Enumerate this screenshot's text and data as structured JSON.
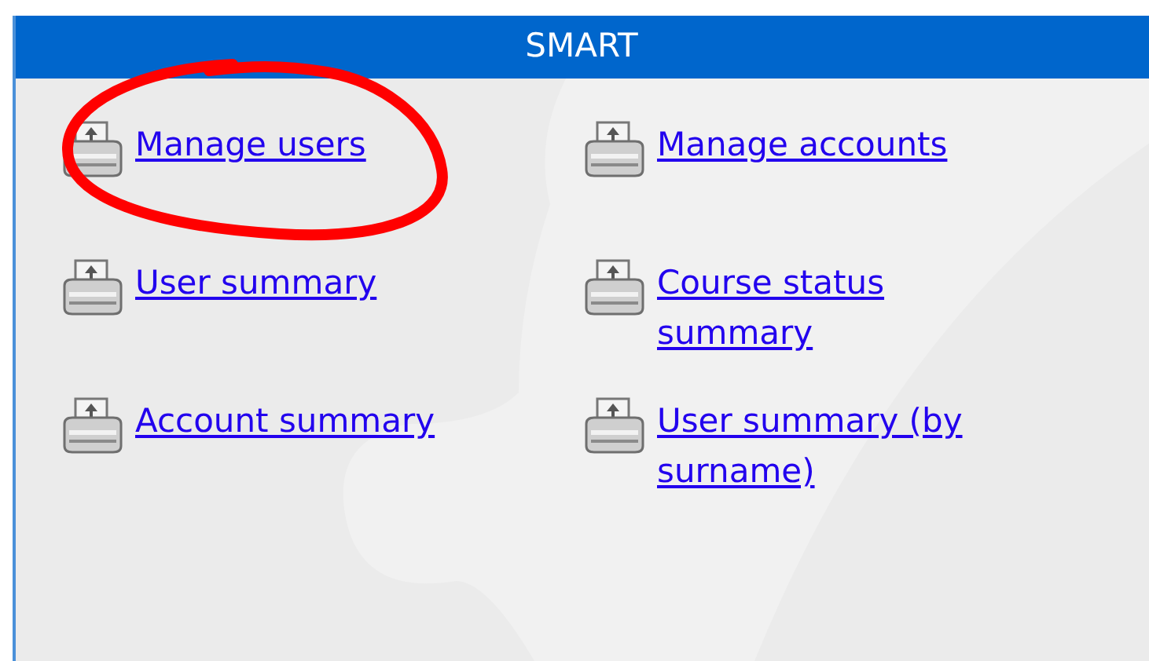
{
  "panel": {
    "title": "SMART",
    "links": [
      {
        "label": "Manage users"
      },
      {
        "label": "Manage accounts"
      },
      {
        "label": "User summary"
      },
      {
        "label": "Course status summary"
      },
      {
        "label": "Account summary"
      },
      {
        "label": "User summary (by surname)"
      }
    ]
  }
}
